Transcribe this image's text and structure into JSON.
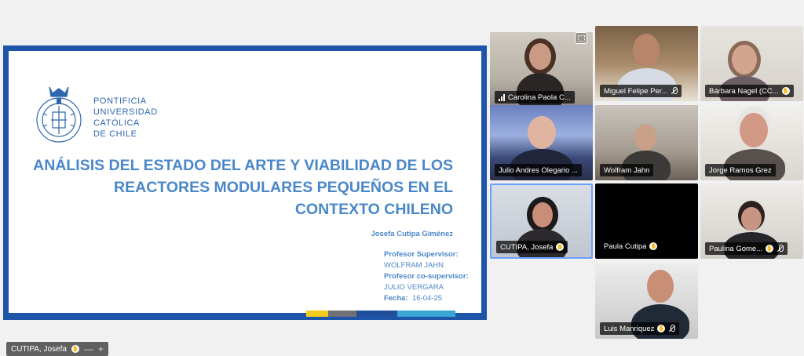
{
  "slide": {
    "university": [
      "PONTIFICIA",
      "UNIVERSIDAD",
      "CATÓLICA",
      "DE CHILE"
    ],
    "title_lines": [
      "ANÁLISIS DEL ESTADO DEL ARTE Y VIABILIDAD DE LOS",
      "REACTORES MODULARES PEQUEÑOS EN EL",
      "CONTEXTO CHILENO"
    ],
    "author": "Josefa Cutipa Giménez",
    "supervisor_label": "Profesor Supervisor:",
    "supervisor_name": "WOLFRAM JAHN",
    "cosupervisor_label": "Profesor co-supervisor:",
    "cosupervisor_name": "JULIO VERGARA",
    "date_label": "Fecha:",
    "date_value": "16-04-25",
    "strip_colors": [
      "#f2cc1d",
      "#6f7177",
      "#1f4e9b",
      "#3aa6d6"
    ]
  },
  "self_view": {
    "name": "CUTIPA, Josefa",
    "minus": "—",
    "plus": "+"
  },
  "participants": [
    {
      "name": "Carolina Paola C...",
      "indicator": "bars"
    },
    {
      "name": "Miguel Felipe Per...",
      "indicator": "mic-muted"
    },
    {
      "name": "Bárbara Nagel (CC...",
      "indicator": "hand"
    },
    {
      "name": "Julio Andres Olegario ...",
      "indicator": "none"
    },
    {
      "name": "Wolfram Jahn",
      "indicator": "none"
    },
    {
      "name": "Jorge Ramos Grez",
      "indicator": "none"
    },
    {
      "name": "CUTIPA, Josefa",
      "indicator": "hand"
    },
    {
      "name": "Paula Cutipa",
      "indicator": "hand"
    },
    {
      "name": "Paulina Gome...",
      "indicator": "hand-mic-muted"
    },
    {
      "name": "Luis Manriquez",
      "indicator": "hand-mic-muted"
    }
  ],
  "colors": {
    "slide_border": "#1e55a8",
    "title": "#4a87c9",
    "active_tile_border": "#6aa0ff"
  }
}
